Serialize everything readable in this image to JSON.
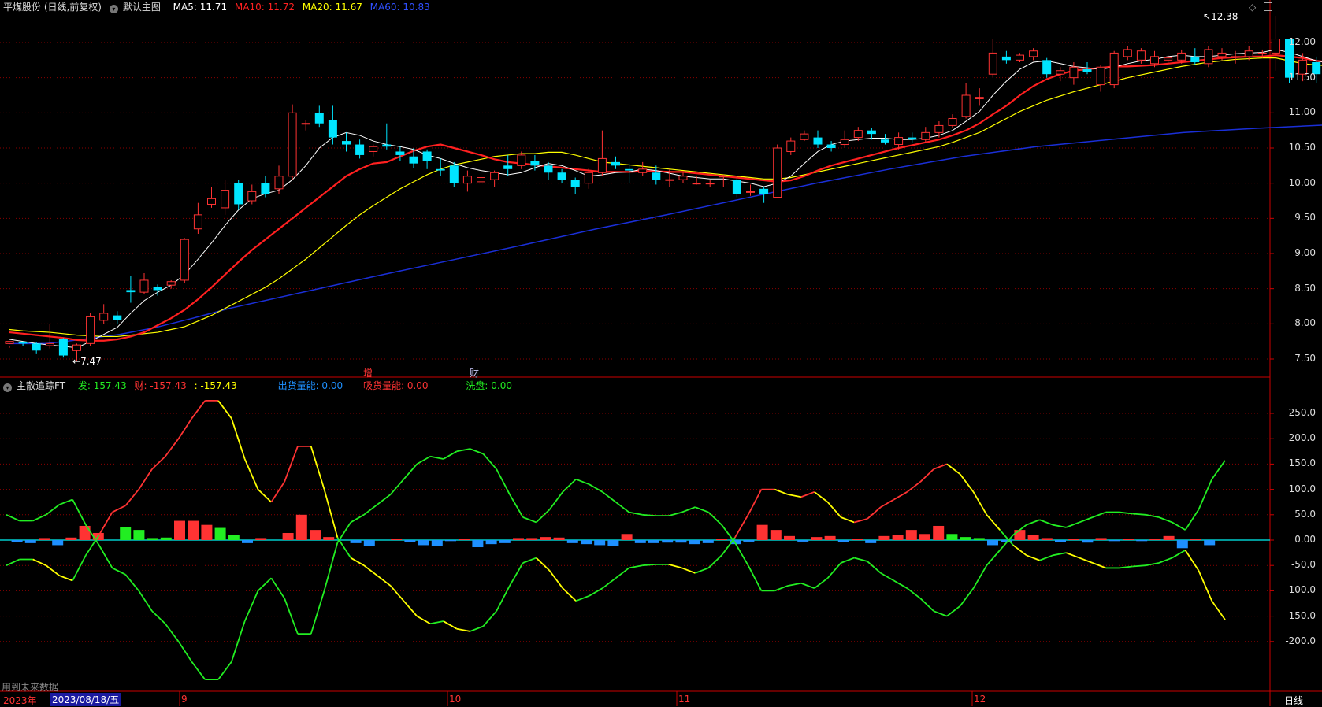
{
  "colors": {
    "up": "#ff3333",
    "down": "#00e5ff",
    "ma5": "#ffffff",
    "ma10": "#ff2020",
    "ma20": "#ffff00",
    "ma60": "#1a2fd8",
    "green": "#22ee22",
    "grid": "#8a0000",
    "axis": "#cc0000",
    "blue": "#1e90ff"
  },
  "header": {
    "stock": "平煤股份 (日线,前复权)",
    "template": "默认主图",
    "ma5_label": "MA5: 11.71",
    "ma10_label": "MA10: 11.72",
    "ma20_label": "MA20: 11.67",
    "ma60_label": "MA60: 10.83"
  },
  "top_icons": [
    "diamond-icon",
    "window-icon"
  ],
  "main_chart": {
    "high_label": "12.38",
    "low_label": "7.47",
    "markers": [
      "增",
      "财"
    ],
    "y_ticks": [
      "12.00",
      "11.50",
      "11.00",
      "10.50",
      "10.00",
      "9.50",
      "9.00",
      "8.50",
      "8.00",
      "7.50"
    ],
    "y_values": [
      12.0,
      11.5,
      11.0,
      10.5,
      10.0,
      9.5,
      9.0,
      8.5,
      8.0,
      7.5
    ]
  },
  "indicator": {
    "name": "主散追踪FT",
    "fa_label": "发: 157.43",
    "cai_label": "财: -157.43",
    "blank_label": ": -157.43",
    "chu_label": "出货量能: 0.00",
    "xi_label": "吸货量能: 0.00",
    "xi_pan_label": "洗盘: 0.00",
    "y_ticks": [
      "250.0",
      "200.0",
      "150.0",
      "100.0",
      "50.0",
      "0.00",
      "-50.0",
      "-100.0",
      "-150.0",
      "-200.0"
    ],
    "y_values": [
      250,
      200,
      150,
      100,
      50,
      0,
      -50,
      -100,
      -150,
      -200
    ]
  },
  "footer": {
    "future_note": "用到未来数据",
    "year": "2023年",
    "date": "2023/08/18/五",
    "months": [
      "9",
      "10",
      "11",
      "12"
    ],
    "period": "日线"
  },
  "candles": [
    [
      7.72,
      7.75,
      7.69,
      7.66
    ],
    [
      7.74,
      7.72,
      7.75,
      7.68
    ],
    [
      7.72,
      7.62,
      7.74,
      7.58
    ],
    [
      7.69,
      7.72,
      8.0,
      7.65
    ],
    [
      7.78,
      7.55,
      7.8,
      7.52
    ],
    [
      7.62,
      7.7,
      7.72,
      7.47
    ],
    [
      7.72,
      8.1,
      8.15,
      7.68
    ],
    [
      8.05,
      8.15,
      8.28,
      8.0
    ],
    [
      8.12,
      8.05,
      8.18,
      8.0
    ],
    [
      8.48,
      8.45,
      8.68,
      8.3
    ],
    [
      8.45,
      8.62,
      8.72,
      8.42
    ],
    [
      8.52,
      8.48,
      8.56,
      8.4
    ],
    [
      8.55,
      8.6,
      8.62,
      8.5
    ],
    [
      8.62,
      9.2,
      9.22,
      8.58
    ],
    [
      9.35,
      9.55,
      9.72,
      9.28
    ],
    [
      9.7,
      9.78,
      9.95,
      9.65
    ],
    [
      9.65,
      9.9,
      10.05,
      9.55
    ],
    [
      10.0,
      9.7,
      10.05,
      9.62
    ],
    [
      9.75,
      9.88,
      9.98,
      9.7
    ],
    [
      10.0,
      9.85,
      10.1,
      9.8
    ],
    [
      9.92,
      10.1,
      10.25,
      9.85
    ],
    [
      10.1,
      11.0,
      11.12,
      10.05
    ],
    [
      10.85,
      10.85,
      10.9,
      10.75
    ],
    [
      11.0,
      10.85,
      11.1,
      10.8
    ],
    [
      10.9,
      10.65,
      11.1,
      10.55
    ],
    [
      10.6,
      10.55,
      10.72,
      10.45
    ],
    [
      10.55,
      10.4,
      10.62,
      10.35
    ],
    [
      10.45,
      10.52,
      10.55,
      10.38
    ],
    [
      10.55,
      10.52,
      10.85,
      10.48
    ],
    [
      10.45,
      10.4,
      10.52,
      10.32
    ],
    [
      10.38,
      10.28,
      10.5,
      10.22
    ],
    [
      10.45,
      10.32,
      10.48,
      10.2
    ],
    [
      10.2,
      10.18,
      10.35,
      10.1
    ],
    [
      10.25,
      10.0,
      10.3,
      9.95
    ],
    [
      10.0,
      10.1,
      10.18,
      9.88
    ],
    [
      10.02,
      10.08,
      10.2,
      10.0
    ],
    [
      10.05,
      10.15,
      10.18,
      9.95
    ],
    [
      10.25,
      10.2,
      10.4,
      10.1
    ],
    [
      10.25,
      10.4,
      10.45,
      10.2
    ],
    [
      10.32,
      10.25,
      10.4,
      10.18
    ],
    [
      10.25,
      10.15,
      10.3,
      10.05
    ],
    [
      10.15,
      10.05,
      10.2,
      10.0
    ],
    [
      10.05,
      9.95,
      10.08,
      9.85
    ],
    [
      10.0,
      10.15,
      10.22,
      9.92
    ],
    [
      10.15,
      10.35,
      10.75,
      10.1
    ],
    [
      10.3,
      10.25,
      10.38,
      10.2
    ],
    [
      10.2,
      10.18,
      10.28,
      10.0
    ],
    [
      10.15,
      10.2,
      10.3,
      10.1
    ],
    [
      10.15,
      10.05,
      10.25,
      9.98
    ],
    [
      10.05,
      10.05,
      10.2,
      9.95
    ],
    [
      10.05,
      10.1,
      10.15,
      10.0
    ],
    [
      10.0,
      10.0,
      10.1,
      9.98
    ],
    [
      10.0,
      10.0,
      10.05,
      9.95
    ],
    [
      10.1,
      10.1,
      10.12,
      9.95
    ],
    [
      10.05,
      9.85,
      10.08,
      9.8
    ],
    [
      9.88,
      9.88,
      9.98,
      9.82
    ],
    [
      9.92,
      9.85,
      9.95,
      9.72
    ],
    [
      9.8,
      10.5,
      10.55,
      9.8
    ],
    [
      10.45,
      10.6,
      10.65,
      10.4
    ],
    [
      10.62,
      10.7,
      10.75,
      10.6
    ],
    [
      10.65,
      10.55,
      10.75,
      10.5
    ],
    [
      10.55,
      10.5,
      10.6,
      10.45
    ],
    [
      10.55,
      10.62,
      10.75,
      10.5
    ],
    [
      10.65,
      10.75,
      10.8,
      10.6
    ],
    [
      10.75,
      10.7,
      10.78,
      10.62
    ],
    [
      10.62,
      10.58,
      10.7,
      10.55
    ],
    [
      10.55,
      10.65,
      10.72,
      10.48
    ],
    [
      10.65,
      10.62,
      10.72,
      10.58
    ],
    [
      10.62,
      10.72,
      10.8,
      10.58
    ],
    [
      10.72,
      10.82,
      10.88,
      10.65
    ],
    [
      10.82,
      10.92,
      10.98,
      10.78
    ],
    [
      10.95,
      11.25,
      11.42,
      10.92
    ],
    [
      11.2,
      11.22,
      11.35,
      11.1
    ],
    [
      11.55,
      11.85,
      12.05,
      11.5
    ],
    [
      11.8,
      11.75,
      11.88,
      11.7
    ],
    [
      11.75,
      11.82,
      11.85,
      11.72
    ],
    [
      11.8,
      11.88,
      11.92,
      11.75
    ],
    [
      11.75,
      11.55,
      11.78,
      11.5
    ],
    [
      11.55,
      11.6,
      11.65,
      11.45
    ],
    [
      11.5,
      11.65,
      11.72,
      11.4
    ],
    [
      11.62,
      11.58,
      11.72,
      11.55
    ],
    [
      11.4,
      11.65,
      11.68,
      11.3
    ],
    [
      11.4,
      11.85,
      11.88,
      11.35
    ],
    [
      11.8,
      11.9,
      11.95,
      11.75
    ],
    [
      11.75,
      11.88,
      11.92,
      11.7
    ],
    [
      11.7,
      11.8,
      11.88,
      11.65
    ],
    [
      11.75,
      11.78,
      11.82,
      11.7
    ],
    [
      11.75,
      11.85,
      11.9,
      11.7
    ],
    [
      11.8,
      11.72,
      11.92,
      11.68
    ],
    [
      11.7,
      11.9,
      11.95,
      11.65
    ],
    [
      11.8,
      11.85,
      11.92,
      11.75
    ],
    [
      11.8,
      11.8,
      11.88,
      11.7
    ],
    [
      11.8,
      11.88,
      11.95,
      11.75
    ],
    [
      11.85,
      11.85,
      11.9,
      11.78
    ],
    [
      11.85,
      12.05,
      12.38,
      11.6
    ],
    [
      12.05,
      11.5,
      12.05,
      11.42
    ],
    [
      11.55,
      11.75,
      11.85,
      11.45
    ],
    [
      11.72,
      11.55,
      11.8,
      11.42
    ],
    [
      11.55,
      11.8,
      11.85,
      11.45
    ]
  ],
  "ma_lines": {
    "ma5": [
      7.78,
      7.75,
      7.72,
      7.7,
      7.68,
      7.66,
      7.75,
      7.85,
      7.95,
      8.15,
      8.33,
      8.45,
      8.55,
      8.7,
      8.92,
      9.15,
      9.4,
      9.62,
      9.78,
      9.85,
      9.9,
      10.05,
      10.25,
      10.5,
      10.65,
      10.72,
      10.68,
      10.6,
      10.55,
      10.52,
      10.48,
      10.4,
      10.35,
      10.28,
      10.22,
      10.18,
      10.15,
      10.12,
      10.15,
      10.22,
      10.28,
      10.25,
      10.18,
      10.1,
      10.12,
      10.15,
      10.16,
      10.2,
      10.18,
      10.14,
      10.1,
      10.08,
      10.06,
      10.06,
      10.03,
      10.0,
      9.95,
      10.0,
      10.1,
      10.28,
      10.45,
      10.55,
      10.6,
      10.62,
      10.64,
      10.64,
      10.62,
      10.62,
      10.64,
      10.68,
      10.75,
      10.88,
      11.02,
      11.25,
      11.45,
      11.62,
      11.72,
      11.74,
      11.7,
      11.66,
      11.64,
      11.62,
      11.65,
      11.7,
      11.74,
      11.76,
      11.8,
      11.82,
      11.8,
      11.8,
      11.82,
      11.84,
      11.85,
      11.86,
      11.9,
      11.86,
      11.8,
      11.74,
      11.71
    ],
    "ma10": [
      7.88,
      7.86,
      7.84,
      7.82,
      7.8,
      7.77,
      7.76,
      7.76,
      7.78,
      7.82,
      7.88,
      7.98,
      8.08,
      8.2,
      8.35,
      8.52,
      8.7,
      8.88,
      9.05,
      9.2,
      9.35,
      9.5,
      9.65,
      9.8,
      9.95,
      10.1,
      10.2,
      10.28,
      10.3,
      10.38,
      10.46,
      10.52,
      10.55,
      10.5,
      10.45,
      10.4,
      10.34,
      10.3,
      10.28,
      10.26,
      10.24,
      10.22,
      10.2,
      10.18,
      10.16,
      10.16,
      10.16,
      10.17,
      10.17,
      10.16,
      10.16,
      10.14,
      10.12,
      10.1,
      10.08,
      10.06,
      10.04,
      10.02,
      10.04,
      10.1,
      10.18,
      10.25,
      10.3,
      10.35,
      10.4,
      10.45,
      10.5,
      10.54,
      10.58,
      10.62,
      10.68,
      10.75,
      10.85,
      10.98,
      11.1,
      11.25,
      11.38,
      11.48,
      11.55,
      11.6,
      11.62,
      11.64,
      11.66,
      11.66,
      11.67,
      11.68,
      11.7,
      11.72,
      11.74,
      11.76,
      11.78,
      11.79,
      11.8,
      11.8,
      11.82,
      11.8,
      11.78,
      11.74,
      11.72
    ],
    "ma20": [
      7.92,
      7.9,
      7.89,
      7.88,
      7.86,
      7.84,
      7.83,
      7.82,
      7.82,
      7.84,
      7.86,
      7.88,
      7.92,
      7.96,
      8.04,
      8.12,
      8.22,
      8.32,
      8.42,
      8.52,
      8.64,
      8.78,
      8.92,
      9.08,
      9.24,
      9.4,
      9.55,
      9.68,
      9.8,
      9.92,
      10.02,
      10.12,
      10.2,
      10.26,
      10.3,
      10.34,
      10.38,
      10.4,
      10.42,
      10.42,
      10.44,
      10.44,
      10.4,
      10.35,
      10.3,
      10.28,
      10.26,
      10.24,
      10.22,
      10.2,
      10.18,
      10.16,
      10.14,
      10.12,
      10.1,
      10.08,
      10.06,
      10.06,
      10.08,
      10.12,
      10.16,
      10.2,
      10.24,
      10.28,
      10.32,
      10.36,
      10.4,
      10.44,
      10.48,
      10.52,
      10.58,
      10.65,
      10.72,
      10.82,
      10.92,
      11.02,
      11.1,
      11.18,
      11.24,
      11.3,
      11.35,
      11.4,
      11.45,
      11.5,
      11.54,
      11.58,
      11.62,
      11.66,
      11.69,
      11.72,
      11.74,
      11.76,
      11.77,
      11.78,
      11.78,
      11.74,
      11.7,
      11.68,
      11.67
    ]
  },
  "ma60": [
    [
      0,
      7.72
    ],
    [
      5,
      7.72
    ],
    [
      10,
      7.78
    ],
    [
      15,
      7.85
    ],
    [
      20,
      7.95
    ],
    [
      25,
      8.08
    ],
    [
      30,
      8.22
    ],
    [
      40,
      8.45
    ],
    [
      50,
      8.68
    ],
    [
      60,
      8.9
    ],
    [
      70,
      9.12
    ],
    [
      80,
      9.35
    ],
    [
      90,
      9.56
    ],
    [
      100,
      9.78
    ],
    [
      110,
      10.0
    ],
    [
      120,
      10.2
    ],
    [
      130,
      10.38
    ],
    [
      140,
      10.52
    ],
    [
      150,
      10.62
    ],
    [
      160,
      10.72
    ],
    [
      170,
      10.78
    ],
    [
      180,
      10.83
    ]
  ],
  "osc": {
    "fa": [
      50,
      38,
      38,
      50,
      70,
      80,
      30,
      -10,
      -55,
      -68,
      -100,
      -140,
      -165,
      -200,
      -240,
      -275,
      -275,
      -240,
      -160,
      -100,
      -75,
      -115,
      -185,
      -185,
      -100,
      -5,
      35,
      50,
      70,
      90,
      120,
      150,
      165,
      160,
      175,
      180,
      170,
      140,
      90,
      45,
      35,
      60,
      95,
      120,
      110,
      95,
      75,
      55,
      50,
      48,
      48,
      55,
      65,
      55,
      30,
      -5,
      -50,
      -100,
      -100,
      -90,
      -85,
      -95,
      -75,
      -45,
      -35,
      -42,
      -65,
      -80,
      -95,
      -115,
      -140,
      -150,
      -130,
      -95,
      -50,
      -20,
      10,
      30,
      40,
      30,
      25,
      35,
      45,
      55,
      55,
      52,
      50,
      45,
      35,
      20,
      60,
      120,
      157
    ],
    "cai": [
      -50,
      -38,
      -38,
      -50,
      -70,
      -80,
      -30,
      10,
      55,
      68,
      100,
      140,
      165,
      200,
      240,
      275,
      275,
      240,
      160,
      100,
      75,
      115,
      185,
      185,
      100,
      5,
      -35,
      -50,
      -70,
      -90,
      -120,
      -150,
      -165,
      -160,
      -175,
      -180,
      -170,
      -140,
      -90,
      -45,
      -35,
      -60,
      -95,
      -120,
      -110,
      -95,
      -75,
      -55,
      -50,
      -48,
      -48,
      -55,
      -65,
      -55,
      -30,
      5,
      50,
      100,
      100,
      90,
      85,
      95,
      75,
      45,
      35,
      42,
      65,
      80,
      95,
      115,
      140,
      150,
      130,
      95,
      50,
      20,
      -10,
      -30,
      -40,
      -30,
      -25,
      -35,
      -45,
      -55,
      -55,
      -52,
      -50,
      -45,
      -35,
      -20,
      -60,
      -120,
      -157
    ],
    "bars": [
      [
        1,
        -4
      ],
      [
        3,
        -6
      ],
      [
        5,
        4
      ],
      [
        7,
        -10
      ],
      [
        9,
        5
      ],
      [
        11,
        28
      ],
      [
        13,
        14
      ],
      [
        17,
        26
      ],
      [
        19,
        20
      ],
      [
        21,
        4
      ],
      [
        23,
        5
      ],
      [
        25,
        38
      ],
      [
        27,
        38
      ],
      [
        29,
        30
      ],
      [
        31,
        24
      ],
      [
        33,
        10
      ],
      [
        35,
        -6
      ],
      [
        37,
        4
      ],
      [
        41,
        14
      ],
      [
        43,
        50
      ],
      [
        45,
        20
      ],
      [
        47,
        6
      ],
      [
        51,
        -6
      ],
      [
        53,
        -12
      ],
      [
        57,
        3
      ],
      [
        59,
        -4
      ],
      [
        61,
        -10
      ],
      [
        63,
        -12
      ],
      [
        65,
        -2
      ],
      [
        67,
        3
      ],
      [
        69,
        -14
      ],
      [
        71,
        -8
      ],
      [
        73,
        -6
      ],
      [
        75,
        4
      ],
      [
        77,
        4
      ],
      [
        79,
        6
      ],
      [
        81,
        5
      ],
      [
        83,
        -6
      ],
      [
        85,
        -8
      ],
      [
        87,
        -10
      ],
      [
        89,
        -12
      ],
      [
        91,
        12
      ],
      [
        93,
        -6
      ],
      [
        95,
        -6
      ],
      [
        97,
        -5
      ],
      [
        99,
        -5
      ],
      [
        101,
        -8
      ],
      [
        103,
        -6
      ],
      [
        105,
        2
      ],
      [
        107,
        -8
      ],
      [
        109,
        -3
      ],
      [
        111,
        30
      ],
      [
        113,
        20
      ],
      [
        115,
        8
      ],
      [
        117,
        -3
      ],
      [
        119,
        6
      ],
      [
        121,
        8
      ],
      [
        123,
        -4
      ],
      [
        125,
        3
      ],
      [
        127,
        -6
      ],
      [
        129,
        8
      ],
      [
        131,
        10
      ],
      [
        133,
        20
      ],
      [
        135,
        12
      ],
      [
        137,
        28
      ],
      [
        139,
        12
      ],
      [
        141,
        6
      ],
      [
        143,
        4
      ],
      [
        145,
        -10
      ],
      [
        147,
        -4
      ],
      [
        149,
        20
      ],
      [
        151,
        10
      ],
      [
        153,
        4
      ],
      [
        155,
        -4
      ],
      [
        157,
        3
      ],
      [
        159,
        -5
      ],
      [
        161,
        4
      ],
      [
        163,
        -2
      ],
      [
        165,
        3
      ],
      [
        167,
        -2
      ],
      [
        169,
        3
      ],
      [
        171,
        8
      ],
      [
        173,
        -16
      ],
      [
        175,
        3
      ],
      [
        177,
        -10
      ]
    ]
  }
}
